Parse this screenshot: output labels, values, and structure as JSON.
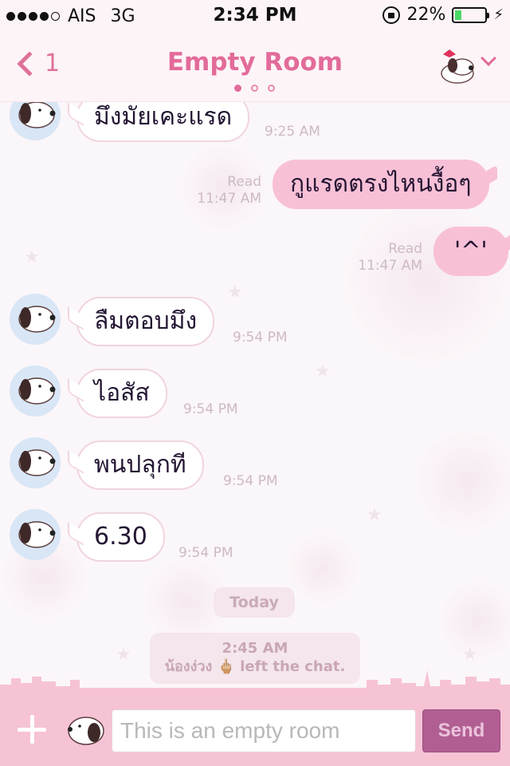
{
  "status_bar": {
    "carrier": "AIS",
    "network": "3G",
    "time": "2:34 PM",
    "battery": "22%",
    "battery_level": 0.22
  },
  "header": {
    "back_count": "1",
    "title": "Empty Room",
    "page_indicator": {
      "count": 3,
      "active": 0
    }
  },
  "messages": [
    {
      "side": "in",
      "text": "มึงมัยเคะแรด",
      "time": "9:25 AM"
    },
    {
      "side": "out",
      "text": "กูแรดตรงไหนงื้อๆ",
      "status": "Read",
      "time": "11:47 AM"
    },
    {
      "side": "out",
      "text": "'^'",
      "status": "Read",
      "time": "11:47 AM"
    },
    {
      "side": "in",
      "text": "ลืมตอบมึง",
      "time": "9:54 PM"
    },
    {
      "side": "in",
      "text": "ไอสัส",
      "time": "9:54 PM"
    },
    {
      "side": "in",
      "text": "พนปลุกที",
      "time": "9:54 PM"
    },
    {
      "side": "in",
      "text": "6.30",
      "time": "9:54 PM"
    }
  ],
  "date_separator": "Today",
  "system_message": {
    "time": "2:45 AM",
    "user": "น้องง่วง",
    "emoji": "🖕🏼",
    "text": "left the chat."
  },
  "input_bar": {
    "placeholder": "This is an empty room",
    "send_label": "Send"
  },
  "colors": {
    "accent": "#e26b9a",
    "bubble_out": "#f8c0d6",
    "send_button": "#b15f93",
    "input_bar": "#f6c3d5"
  }
}
